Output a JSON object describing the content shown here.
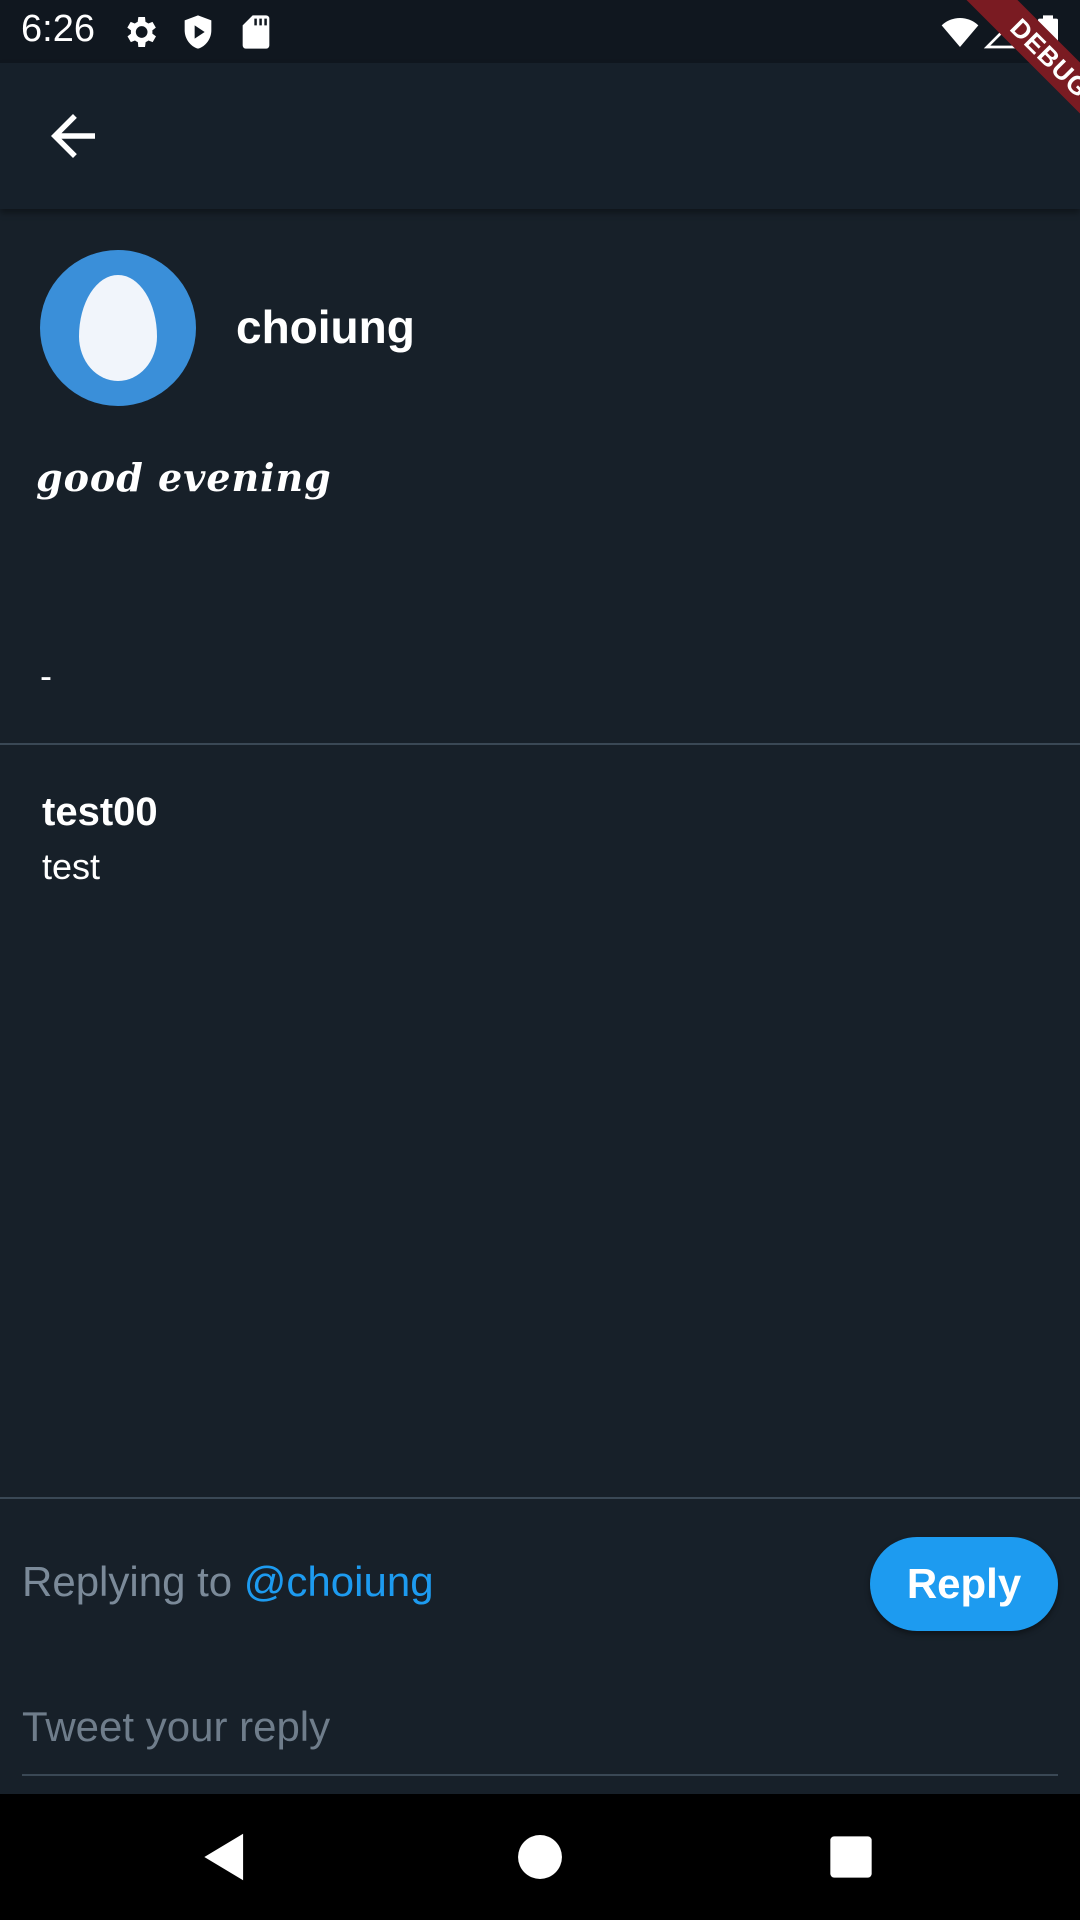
{
  "status_bar": {
    "time": "6:26",
    "left_icons": [
      "gear-icon",
      "shield-play-icon",
      "sd-card-icon"
    ],
    "right_icons": [
      "wifi-icon",
      "signal-icon",
      "battery-icon"
    ]
  },
  "debug_banner": {
    "label": "DEBUG",
    "color": "#7a1b22"
  },
  "app_bar": {
    "back_icon": "arrow-left-icon"
  },
  "tweet": {
    "author": "choiung",
    "avatar_color": "#3a8fd9",
    "text": "good evening",
    "meta": "-"
  },
  "replies": [
    {
      "user": "test00",
      "text": "test"
    }
  ],
  "composer": {
    "replying_prefix": "Replying to ",
    "replying_handle": "@choiung",
    "reply_button": "Reply",
    "placeholder": "Tweet your reply",
    "accent": "#1d9bf0"
  },
  "nav_bar": {
    "icons": [
      "back-triangle-icon",
      "home-circle-icon",
      "recents-square-icon"
    ]
  }
}
